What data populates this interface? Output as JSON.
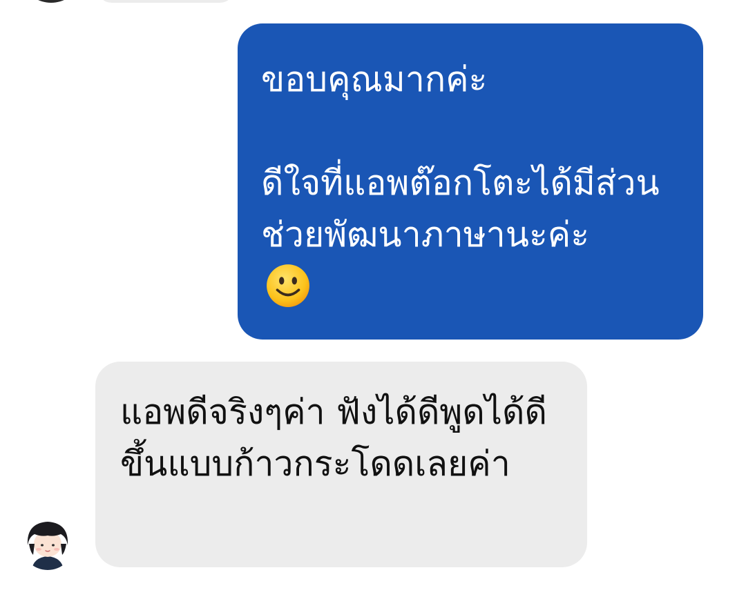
{
  "conversation": {
    "outgoing_message": {
      "text": "ขอบคุณมากค่ะ\n\nดีใจที่แอพต๊อกโตะได้มีส่วนช่วยพัฒนาภาษานะค่ะ",
      "emoji": "slightly-smiling-face",
      "bubble_color": "#1a56b5",
      "text_color": "#ffffff"
    },
    "incoming_message": {
      "text": "แอพดีจริงๆค่า ฟังได้ดีพูดได้ดีขึ้นแบบก้าวกระโดดเลยค่า",
      "bubble_color": "#ececec",
      "text_color": "#111111"
    },
    "sender_avatar": {
      "icon": "cartoon-person-avatar"
    }
  }
}
